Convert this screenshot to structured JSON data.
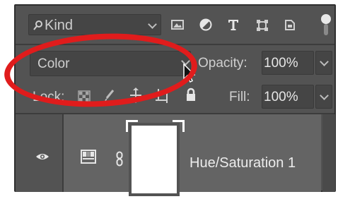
{
  "filter": {
    "label": "Kind"
  },
  "blend_mode": {
    "value": "Color"
  },
  "opacity": {
    "label": "Opacity:",
    "value": "100%"
  },
  "lock": {
    "label": "Lock:"
  },
  "fill": {
    "label": "Fill:",
    "value": "100%"
  },
  "layer": {
    "name": "Hue/Saturation 1"
  },
  "colors": {
    "panel": "#535353",
    "highlight": "#e01c1c"
  }
}
